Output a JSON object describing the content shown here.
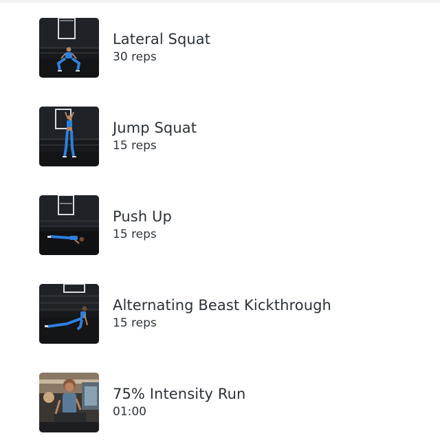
{
  "exercises": [
    {
      "name": "Lateral Squat",
      "detail": "30 reps",
      "thumbnail": "lateral-squat-photo"
    },
    {
      "name": "Jump Squat",
      "detail": "15 reps",
      "thumbnail": "jump-squat-photo"
    },
    {
      "name": "Push Up",
      "detail": "15 reps",
      "thumbnail": "push-up-photo"
    },
    {
      "name": "Alternating Beast Kickthrough",
      "detail": "15 reps",
      "thumbnail": "beast-kickthrough-photo"
    },
    {
      "name": "75% Intensity Run",
      "detail": "01:00",
      "thumbnail": "treadmill-run-photo"
    }
  ],
  "colors": {
    "text": "#2b3038",
    "outfit_blue": "#2f7fe0",
    "gym_dark": "#16181b"
  }
}
